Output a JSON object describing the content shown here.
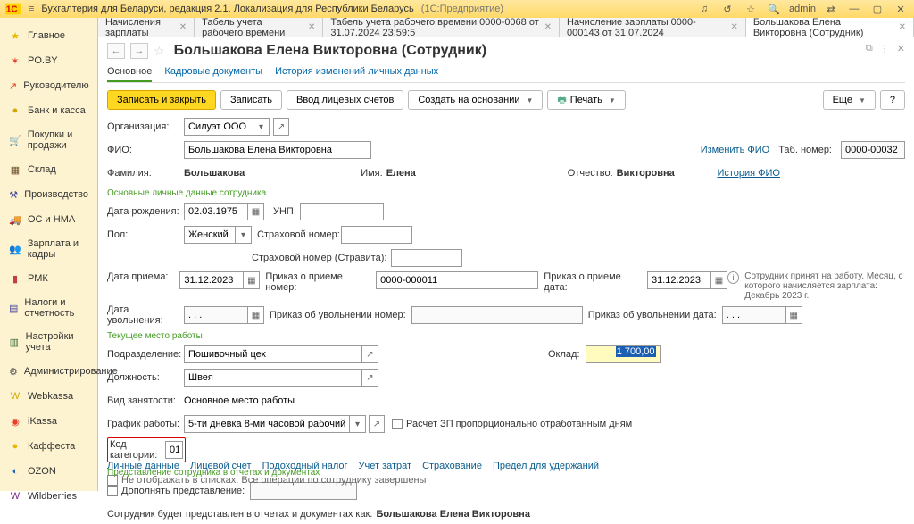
{
  "titlebar": {
    "app": "Бухгалтерия для Беларуси, редакция 2.1. Локализация для Республики Беларусь",
    "mode": "(1С:Предприятие)",
    "user": "admin"
  },
  "tabs": [
    {
      "label": "Начисления зарплаты"
    },
    {
      "label": "Табель учета рабочего времени"
    },
    {
      "label": "Табель учета рабочего времени 0000-0068 от 31.07.2024 23:59:5"
    },
    {
      "label": "Начисление зарплаты 0000-000143 от 31.07.2024"
    },
    {
      "label": "Большакова Елена Викторовна (Сотрудник)",
      "active": true
    }
  ],
  "sidebar": [
    {
      "label": "Главное",
      "color": "#e6b800",
      "g": "★"
    },
    {
      "label": "PO.BY",
      "color": "#e83e2a",
      "g": "✶"
    },
    {
      "label": "Руководителю",
      "color": "#e83e2a",
      "g": "↗"
    },
    {
      "label": "Банк и касса",
      "color": "#d4a700",
      "g": "●"
    },
    {
      "label": "Покупки и продажи",
      "color": "#c24040",
      "g": "🛒"
    },
    {
      "label": "Склад",
      "color": "#6b4f2a",
      "g": "▦"
    },
    {
      "label": "Производство",
      "color": "#4a4a9a",
      "g": "⚒"
    },
    {
      "label": "ОС и НМА",
      "color": "#3a6a3a",
      "g": "🚚"
    },
    {
      "label": "Зарплата и кадры",
      "color": "#6a3a8a",
      "g": "👥"
    },
    {
      "label": "РМК",
      "color": "#c24040",
      "g": "▮"
    },
    {
      "label": "Налоги и отчетность",
      "color": "#4a4a9a",
      "g": "▤"
    },
    {
      "label": "Настройки учета",
      "color": "#3a6a3a",
      "g": "▥"
    },
    {
      "label": "Администрирование",
      "color": "#555",
      "g": "⚙"
    },
    {
      "label": "Webkassa",
      "color": "#d4a700",
      "g": "W"
    },
    {
      "label": "iKassa",
      "color": "#e83e2a",
      "g": "◉"
    },
    {
      "label": "Каффеста",
      "color": "#e6b800",
      "g": "●"
    },
    {
      "label": "OZON",
      "color": "#1a5fb4",
      "g": "◐"
    },
    {
      "label": "Wildberries",
      "color": "#7a2a8a",
      "g": "W"
    }
  ],
  "page": {
    "title": "Большакова Елена Викторовна (Сотрудник)",
    "subtabs": [
      "Основное",
      "Кадровые документы",
      "История изменений личных данных"
    ],
    "toolbar": {
      "save_close": "Записать и закрыть",
      "save": "Записать",
      "acc": "Ввод лицевых счетов",
      "create": "Создать на основании",
      "print": "Печать",
      "more": "Еще",
      "help": "?"
    },
    "f": {
      "org_l": "Организация:",
      "org": "Силуэт ООО",
      "fio_l": "ФИО:",
      "fio": "Большакова Елена Викторовна",
      "tab_l": "Таб. номер:",
      "tab": "0000-00032",
      "change_fio": "Изменить ФИО",
      "hist_fio": "История ФИО",
      "surname_l": "Фамилия:",
      "surname": "Большакова",
      "name_l": "Имя:",
      "name": "Елена",
      "patr_l": "Отчество:",
      "patr": "Викторовна",
      "sec1": "Основные личные данные сотрудника",
      "dob_l": "Дата рождения:",
      "dob": "02.03.1975",
      "unp_l": "УНП:",
      "sex_l": "Пол:",
      "sex": "Женский",
      "insnum_l": "Страховой номер:",
      "insnum2_l": "Страховой номер (Стравита):",
      "hire_l": "Дата приема:",
      "hire": "31.12.2023",
      "hireord_l": "Приказ о приеме номер:",
      "hireord": "0000-000011",
      "hireordd_l": "Приказ о приеме дата:",
      "hireordd": "31.12.2023",
      "fire_l": "Дата увольнения:",
      "fire": ". . .",
      "fireord_l": "Приказ об увольнении номер:",
      "fireordd_l": "Приказ об увольнении дата:",
      "fireordd": ". . .",
      "info": "Сотрудник принят на работу. Месяц, с которого начисляется зарплата: Декабрь 2023 г.",
      "sec2": "Текущее место работы",
      "dept_l": "Подразделение:",
      "dept": "Пошивочный цех",
      "pos_l": "Должность:",
      "pos": "Швея",
      "salary_l": "Оклад:",
      "salary": "1 700,00",
      "emp_l": "Вид занятости:",
      "emp": "Основное место работы",
      "sched_l": "График работы:",
      "sched": "5-ти дневка 8-ми часовой рабочий день",
      "prop": "Расчет ЗП пропорционально отработанным дням",
      "cat_l": "Код категории:",
      "cat": "01",
      "sec3": "Представление сотрудника в отчетах и документах",
      "supp_l": "Дополнять представление:",
      "rep1": "Сотрудник будет представлен в отчетах и документах как:",
      "rep2": "Большакова Елена Викторовна"
    },
    "footer": {
      "links": [
        "Личные данные",
        "Лицевой счет",
        "Подоходный налог",
        "Учет затрат",
        "Страхование",
        "Предел для удержаний"
      ],
      "hide": "Не отображать в списках. Все операции по сотруднику завершены"
    }
  }
}
